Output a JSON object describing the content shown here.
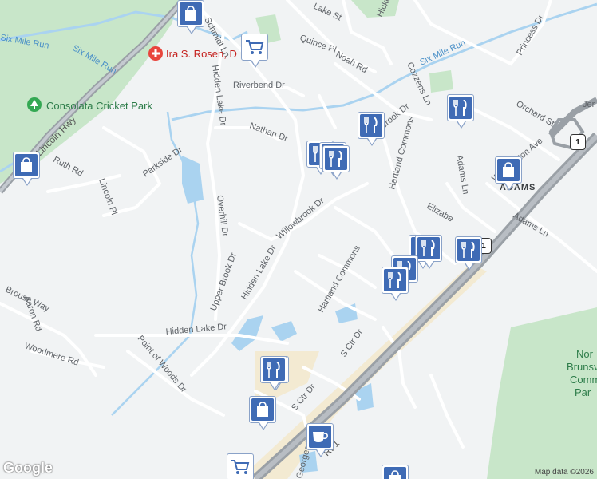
{
  "map": {
    "attribution": "Map data ©2026",
    "logo": "Google",
    "area_label": "ADAMS",
    "poi": {
      "hospital": "Ira S. Rosen, D",
      "park": "Consolata Cricket Park",
      "park_partial": "Nor\nBrunsv\nComm\nPar"
    },
    "water_labels": [
      "Six Mile Run",
      "Six Mile Run"
    ],
    "highway_labels": {
      "lincoln": "Lincoln Hwy",
      "rt1": "Rt-1",
      "route_shield": "1"
    },
    "streets": [
      "Schmidt Ln",
      "Quince Pl",
      "Noah Rd",
      "Lake St",
      "Hickory",
      "Princess Dr",
      "Cozzens Ln",
      "Riverbend Dr",
      "Nathan Dr",
      "Brook Dr",
      "Orchard St",
      "Parkside Dr",
      "Ruth Rd",
      "Lincoln Pl",
      "Hidden Lake Dr",
      "Overhill Dr",
      "Willowbrook Dr",
      "Hartland Commons",
      "Adams Ln",
      "Elizabe",
      "Washington Ave",
      "Upper Brook Dr",
      "Hidden Lake Dr",
      "Brouse Way",
      "Aaron Rd",
      "Woodmere Rd",
      "Hidden Lake Dr",
      "Point of Woods Dr",
      "Hartland Commons",
      "S Ctr Dr",
      "S Ctr Dr",
      "Georges Rd",
      "Adams Ln",
      "Jer"
    ],
    "markers": [
      {
        "type": "shopping",
        "icon": "shopping-bag-icon"
      },
      {
        "type": "grocery",
        "icon": "shopping-cart-icon"
      },
      {
        "type": "shopping",
        "icon": "shopping-bag-icon"
      },
      {
        "type": "restaurant",
        "icon": "fork-knife-icon"
      },
      {
        "type": "restaurant",
        "icon": "fork-knife-icon"
      },
      {
        "type": "restaurant",
        "icon": "fork-knife-icon"
      },
      {
        "type": "restaurant",
        "icon": "fork-knife-icon"
      },
      {
        "type": "shopping",
        "icon": "shopping-bag-icon"
      },
      {
        "type": "restaurant",
        "icon": "fork-knife-icon"
      },
      {
        "type": "restaurant",
        "icon": "fork-knife-icon"
      },
      {
        "type": "restaurant",
        "icon": "fork-knife-icon"
      },
      {
        "type": "restaurant",
        "icon": "fork-knife-icon"
      },
      {
        "type": "restaurant",
        "icon": "fork-knife-icon"
      },
      {
        "type": "restaurant",
        "icon": "fork-knife-icon"
      },
      {
        "type": "shopping",
        "icon": "shopping-bag-icon"
      },
      {
        "type": "restaurant",
        "icon": "fork-knife-icon"
      },
      {
        "type": "shopping",
        "icon": "shopping-bag-icon"
      },
      {
        "type": "cafe",
        "icon": "coffee-cup-icon"
      },
      {
        "type": "grocery",
        "icon": "shopping-cart-icon"
      },
      {
        "type": "shopping",
        "icon": "shopping-bag-icon"
      }
    ],
    "colors": {
      "background": "#f1f3f4",
      "park": "#c8e6c9",
      "water": "#aad3f0",
      "highway": "#9aa0a6",
      "commercial": "#f3ead2",
      "marker": "#3f6bb5"
    }
  }
}
